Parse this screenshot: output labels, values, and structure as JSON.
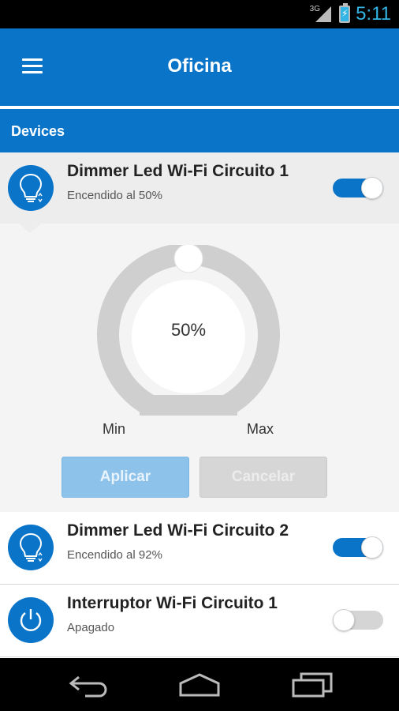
{
  "status_bar": {
    "network": "3G",
    "time": "5:11",
    "icons": [
      "signal-icon",
      "battery-charging-icon"
    ]
  },
  "app_bar": {
    "title": "Oficina",
    "menu_icon": "hamburger-menu-icon"
  },
  "section": {
    "title": "Devices"
  },
  "devices": [
    {
      "name": "Dimmer Led Wi-Fi Circuito 1",
      "status": "Encendido al 50%",
      "icon": "bulb-icon",
      "on": true,
      "expanded": true
    },
    {
      "name": "Dimmer Led Wi-Fi Circuito 2",
      "status": "Encendido al 92%",
      "icon": "bulb-icon",
      "on": true,
      "expanded": false
    },
    {
      "name": "Interruptor Wi-Fi Circuito 1",
      "status": "Apagado",
      "icon": "power-icon",
      "on": false,
      "expanded": false
    }
  ],
  "dimmer": {
    "value_label": "50%",
    "level": 0.5,
    "min_label": "Min",
    "max_label": "Max",
    "apply_label": "Aplicar",
    "cancel_label": "Cancelar"
  },
  "nav_bar": {
    "icons": [
      "back-icon",
      "home-icon",
      "recent-apps-icon"
    ]
  },
  "colors": {
    "primary": "#0a74c9",
    "dial_track": "#cfcfcf",
    "status_time": "#33b5e5"
  }
}
